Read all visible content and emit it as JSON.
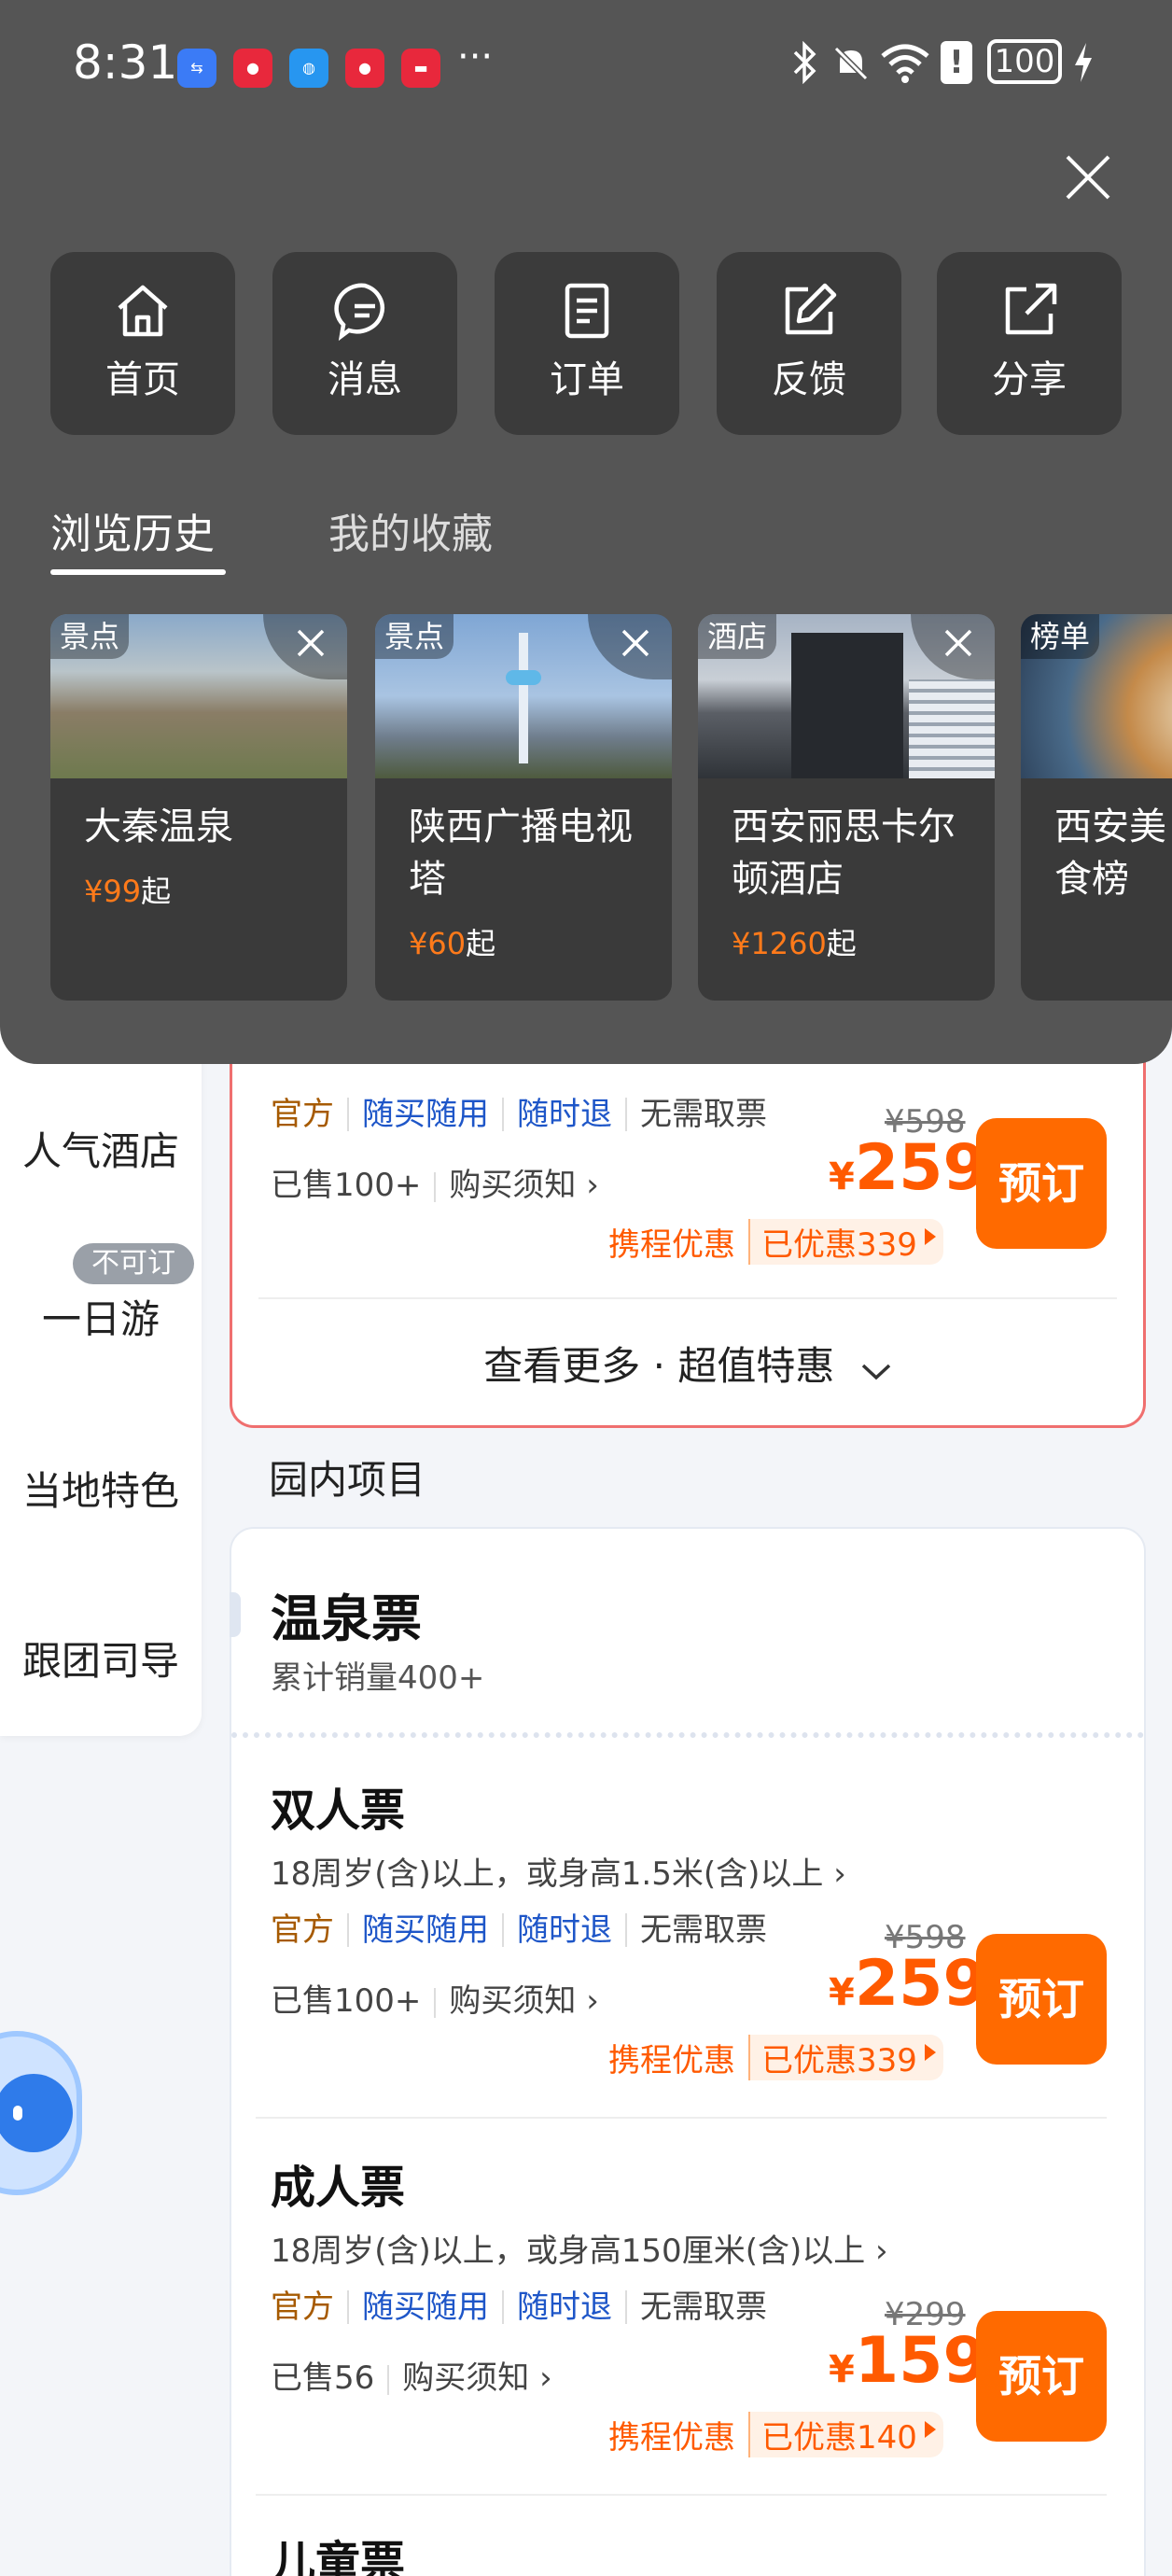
{
  "status_bar": {
    "time": "8:31",
    "battery": "100",
    "more": "···"
  },
  "quick_actions": [
    {
      "label": "首页",
      "icon": "home-icon"
    },
    {
      "label": "消息",
      "icon": "message-icon"
    },
    {
      "label": "订单",
      "icon": "order-icon"
    },
    {
      "label": "反馈",
      "icon": "feedback-icon"
    },
    {
      "label": "分享",
      "icon": "share-icon"
    }
  ],
  "tabs": {
    "history": "浏览历史",
    "favorites": "我的收藏"
  },
  "history": [
    {
      "badge": "景点",
      "name": "大秦温泉",
      "price": "¥99",
      "suffix": "起"
    },
    {
      "badge": "景点",
      "name": "陕西广播电视塔",
      "price": "¥60",
      "suffix": "起"
    },
    {
      "badge": "酒店",
      "name": "西安丽思卡尔顿酒店",
      "price": "¥1260",
      "suffix": "起"
    },
    {
      "badge": "榜单",
      "name": "西安美食榜",
      "price": "",
      "suffix": ""
    }
  ],
  "left_nav": [
    {
      "label": "人气酒店"
    },
    {
      "label": "一日游",
      "badge": "不可订"
    },
    {
      "label": "当地特色"
    },
    {
      "label": "跟团司导"
    }
  ],
  "tags": {
    "official": "官方",
    "buy_use": "随买随用",
    "refund": "随时退",
    "no_ticket": "无需取票"
  },
  "purchase_notice": "购买须知",
  "book_label": "预订",
  "promo_label": "携程优惠",
  "currency": "¥",
  "top_card": {
    "sold": "已售100+",
    "original": "¥598",
    "price": "259",
    "discount": "已优惠339",
    "more": "查看更多 · 超值特惠"
  },
  "section_title": "园内项目",
  "group": {
    "title": "温泉票",
    "sales": "累计销量400+"
  },
  "products": [
    {
      "title": "双人票",
      "desc": "18周岁(含)以上，或身高1.5米(含)以上",
      "sold": "已售100+",
      "original": "¥598",
      "price": "259",
      "discount": "已优惠339"
    },
    {
      "title": "成人票",
      "desc": "18周岁(含)以上，或身高150厘米(含)以上",
      "sold": "已售56",
      "original": "¥299",
      "price": "159",
      "discount": "已优惠140"
    },
    {
      "title": "儿童票"
    }
  ]
}
